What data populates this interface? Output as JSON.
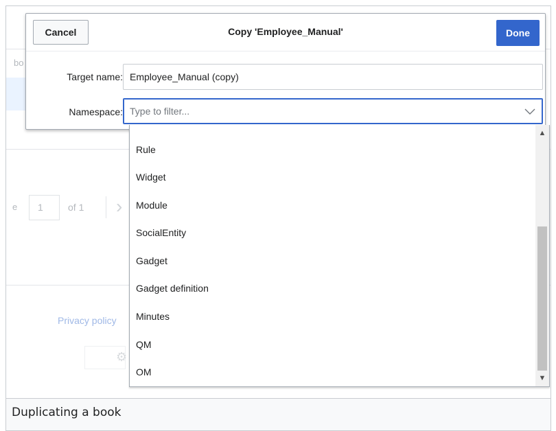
{
  "dialog": {
    "cancel_label": "Cancel",
    "title": "Copy 'Employee_Manual'",
    "done_label": "Done",
    "target_name_label": "Target name:",
    "target_name_value": "Employee_Manual (copy)",
    "namespace_label": "Namespace:",
    "namespace_placeholder": "Type to filter..."
  },
  "namespace_options": [
    "Rule",
    "Widget",
    "Module",
    "SocialEntity",
    "Gadget",
    "Gadget definition",
    "Minutes",
    "QM",
    "OM"
  ],
  "background": {
    "pager_value": "1",
    "pager_of": "of 1",
    "privacy_link": "Privacy policy",
    "fragment_bo": "bo",
    "fragment_e": "e"
  },
  "caption": "Duplicating a book",
  "colors": {
    "accent": "#3366cc",
    "border": "#a2a9b1",
    "text": "#202122"
  }
}
